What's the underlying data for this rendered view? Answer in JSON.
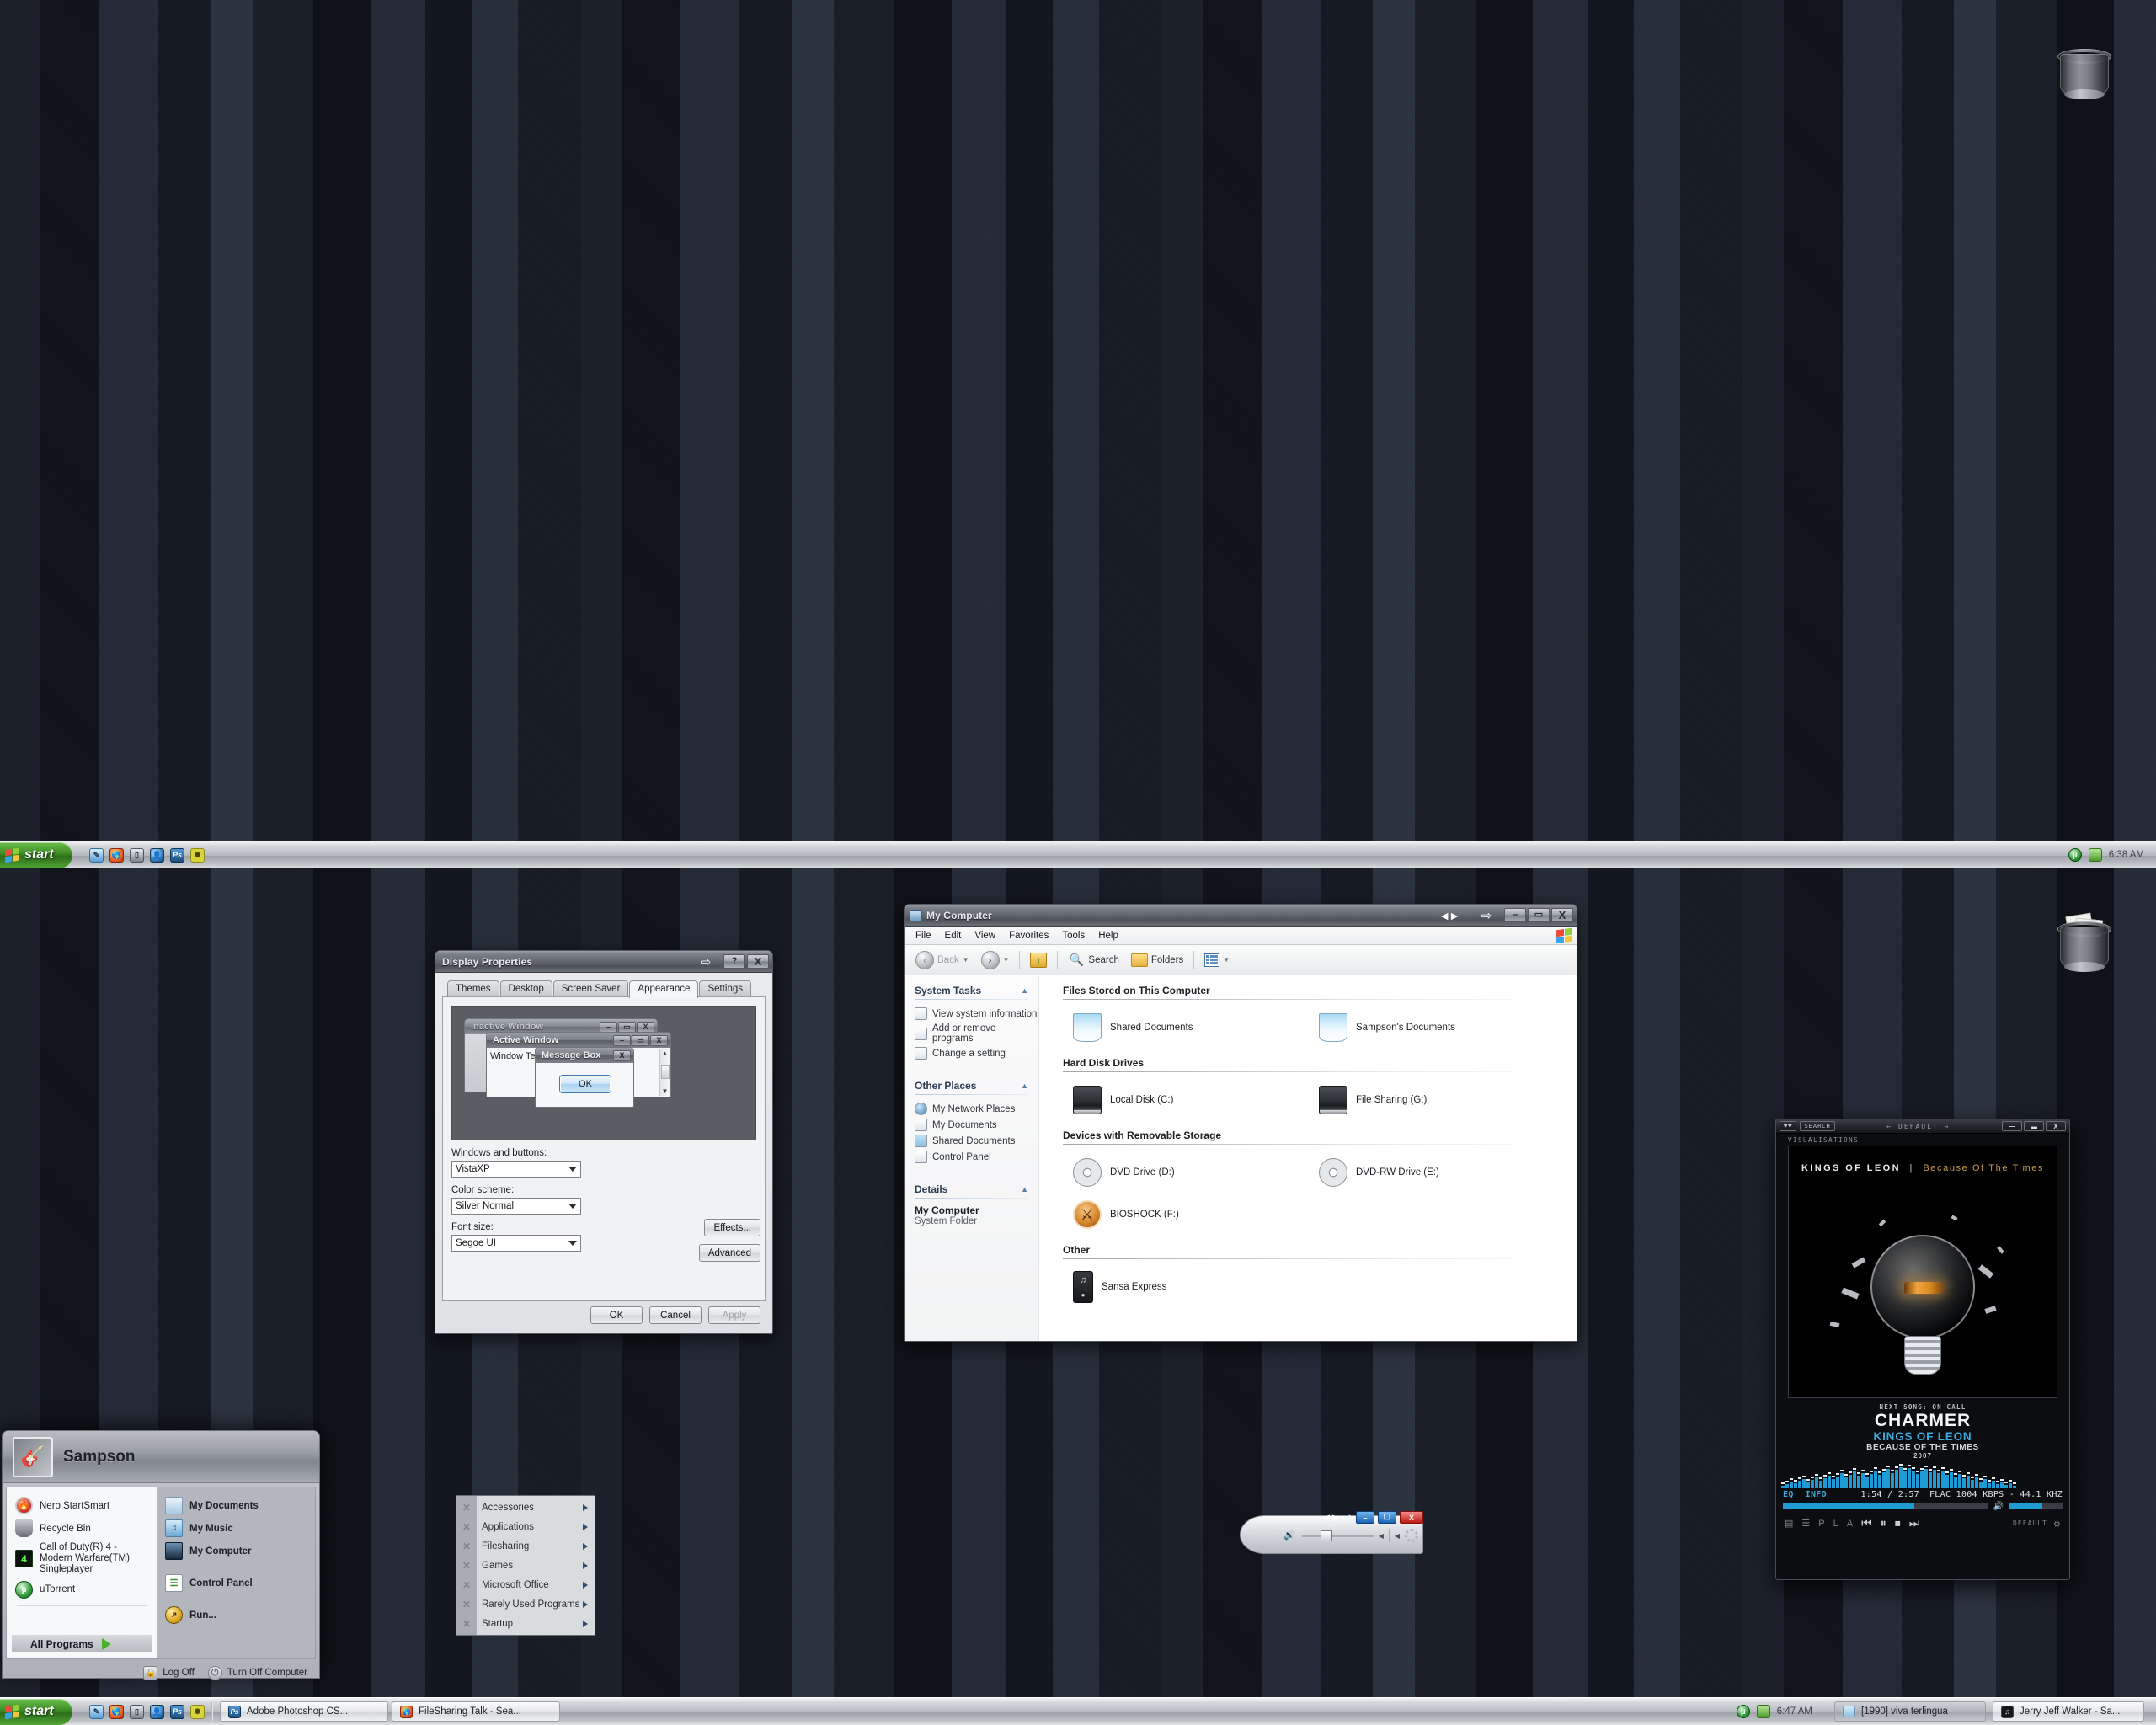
{
  "desktop": {
    "icons": [
      {
        "name": "recycle-bin-empty",
        "label": ""
      },
      {
        "name": "recycle-bin-full",
        "label": ""
      }
    ]
  },
  "display_properties": {
    "title": "Display Properties",
    "buttons": {
      "rollup": "⇨",
      "help": "?",
      "close": "X"
    },
    "tabs": [
      {
        "label": "Themes",
        "active": false
      },
      {
        "label": "Desktop",
        "active": false
      },
      {
        "label": "Screen Saver",
        "active": false
      },
      {
        "label": "Appearance",
        "active": true
      },
      {
        "label": "Settings",
        "active": false
      }
    ],
    "preview": {
      "inactive_window_title": "Inactive Window",
      "active_window_title": "Active Window",
      "window_text": "Window Text",
      "message_box_title": "Message Box",
      "message_box_ok": "OK",
      "min_label": "–",
      "max_label": "▭",
      "close_label": "X"
    },
    "fields": [
      {
        "label": "Windows and buttons:",
        "value": "VistaXP"
      },
      {
        "label": "Color scheme:",
        "value": "Silver Normal"
      },
      {
        "label": "Font size:",
        "value": "Segoe UI"
      }
    ],
    "side_buttons": [
      {
        "label": "Effects..."
      },
      {
        "label": "Advanced"
      }
    ],
    "dialog_buttons": [
      {
        "label": "OK",
        "disabled": false
      },
      {
        "label": "Cancel",
        "disabled": false
      },
      {
        "label": "Apply",
        "disabled": true
      }
    ]
  },
  "my_computer": {
    "title": "My Computer",
    "window_buttons": {
      "minimize": "–",
      "maximize": "▭",
      "close": "X"
    },
    "menu": [
      "File",
      "Edit",
      "View",
      "Favorites",
      "Tools",
      "Help"
    ],
    "toolbar": {
      "back": "Back",
      "forward": "",
      "up": "",
      "search": "Search",
      "folders": "Folders",
      "views": ""
    },
    "sidebar": {
      "system_tasks": {
        "heading": "System Tasks",
        "items": [
          "View system information",
          "Add or remove programs",
          "Change a setting"
        ]
      },
      "other_places": {
        "heading": "Other Places",
        "items": [
          "My Network Places",
          "My Documents",
          "Shared Documents",
          "Control Panel"
        ]
      },
      "details": {
        "heading": "Details",
        "name": "My Computer",
        "type": "System Folder"
      }
    },
    "groups": [
      {
        "heading": "Files Stored on This Computer",
        "items": [
          {
            "label": "Shared Documents",
            "icon": "folder"
          },
          {
            "label": "Sampson's Documents",
            "icon": "folder"
          }
        ]
      },
      {
        "heading": "Hard Disk Drives",
        "items": [
          {
            "label": "Local Disk (C:)",
            "icon": "hdd"
          },
          {
            "label": "File Sharing (G:)",
            "icon": "hdd"
          }
        ]
      },
      {
        "heading": "Devices with Removable Storage",
        "items": [
          {
            "label": "DVD Drive (D:)",
            "icon": "cd"
          },
          {
            "label": "DVD-RW Drive (E:)",
            "icon": "cd"
          },
          {
            "label": "BIOSHOCK (F:)",
            "icon": "bioshock"
          }
        ]
      },
      {
        "heading": "Other",
        "items": [
          {
            "label": "Sansa Express",
            "icon": "mp3"
          }
        ]
      }
    ]
  },
  "media_player": {
    "search_label": "SEARCH",
    "skin_label": "DEFAULT",
    "prev_arrow": "←",
    "next_arrow": "→",
    "window_buttons": {
      "minimize": "—",
      "maximize": "▬",
      "close": "X"
    },
    "visualisations_label": "VISUALISATIONS",
    "album_art": {
      "band": "KINGS OF LEON",
      "divider": "|",
      "album": "Because Of The Times"
    },
    "now_playing": {
      "next_song": "NEXT SONG: ON CALL",
      "title": "CHARMER",
      "artist": "KINGS OF LEON",
      "album": "BECAUSE OF THE TIMES",
      "year": "2007"
    },
    "status": {
      "eq": "EQ",
      "info": "INFO",
      "time": "1:54 / 2:57",
      "format": "FLAC 1004 KBPS - 44.1 KHZ"
    },
    "progress_percent": 64,
    "volume_percent": 62,
    "controls": {
      "prev": "⏮",
      "pause": "⏸",
      "stop": "⏹",
      "next": "⏭",
      "preset": "DEFAULT",
      "settings": "⚙"
    },
    "spectrum": [
      3,
      5,
      8,
      6,
      9,
      11,
      7,
      10,
      13,
      9,
      12,
      15,
      11,
      14,
      18,
      13,
      16,
      20,
      15,
      18,
      14,
      17,
      21,
      16,
      19,
      23,
      18,
      22,
      25,
      20,
      24,
      21,
      17,
      20,
      23,
      19,
      22,
      18,
      21,
      16,
      19,
      14,
      17,
      12,
      15,
      10,
      13,
      8,
      11,
      6,
      9,
      5,
      7,
      4,
      6,
      3
    ]
  },
  "wmp_widget": {
    "window_buttons": {
      "minimize": "–",
      "maximize": "❐",
      "close": "X"
    },
    "volume_percent": 26
  },
  "taskbar_top": {
    "start_label": "start",
    "quick_launch": [
      "notepad-icon",
      "firefox-icon",
      "show-desktop-icon",
      "msn-icon",
      "photoshop-icon",
      "bone-icon"
    ],
    "tray_icons": [
      "utorrent-tray-icon",
      "user-tray-icon"
    ],
    "clock": "6:38 AM",
    "tasks": []
  },
  "taskbar_bottom": {
    "start_label": "start",
    "quick_launch": [
      "notepad-icon",
      "firefox-icon",
      "show-desktop-icon",
      "msn-icon",
      "photoshop-icon",
      "bone-icon"
    ],
    "tasks": [
      {
        "label": "Adobe Photoshop CS...",
        "icon": "photoshop-icon",
        "active": false
      },
      {
        "label": "FileSharing Talk - Sea...",
        "icon": "firefox-icon",
        "active": false
      }
    ],
    "tray_icons": [
      "utorrent-tray-icon",
      "user-tray-icon"
    ],
    "clock": "6:47 AM",
    "tasks_right": [
      {
        "label": "[1990] viva terlingua",
        "icon": "folder-icon",
        "active": true
      },
      {
        "label": "Jerry Jeff Walker - Sa...",
        "icon": "player-icon",
        "active": false
      }
    ]
  },
  "start_menu": {
    "user": "Sampson",
    "avatar_icon": "guitar-icon",
    "left_items": [
      {
        "label": "Nero StartSmart",
        "icon": "nero-icon"
      },
      {
        "label": "Recycle Bin",
        "icon": "recycle-bin-icon"
      },
      {
        "label": "Call of Duty(R) 4 - Modern Warfare(TM) Singleplayer",
        "icon": "cod4-icon"
      },
      {
        "label": "uTorrent",
        "icon": "utorrent-icon"
      }
    ],
    "all_programs": "All Programs",
    "right_items": [
      {
        "label": "My Documents",
        "icon": "my-documents-icon",
        "divider_after": false
      },
      {
        "label": "My Music",
        "icon": "my-music-icon",
        "divider_after": false
      },
      {
        "label": "My Computer",
        "icon": "my-computer-icon",
        "divider_after": true
      },
      {
        "label": "Control Panel",
        "icon": "control-panel-icon",
        "divider_after": true
      },
      {
        "label": "Run...",
        "icon": "run-icon",
        "divider_after": false
      }
    ],
    "log_off": "Log Off",
    "turn_off": "Turn Off Computer"
  },
  "all_programs_menu": {
    "items": [
      {
        "label": "Accessories"
      },
      {
        "label": "Applications"
      },
      {
        "label": "Filesharing"
      },
      {
        "label": "Games"
      },
      {
        "label": "Microsoft Office"
      },
      {
        "label": "Rarely Used Programs"
      },
      {
        "label": "Startup"
      }
    ]
  },
  "colors": {
    "accent_blue": "#1e9bd4",
    "start_green": "#3f8f28",
    "desktop_dark": "#14181e"
  }
}
